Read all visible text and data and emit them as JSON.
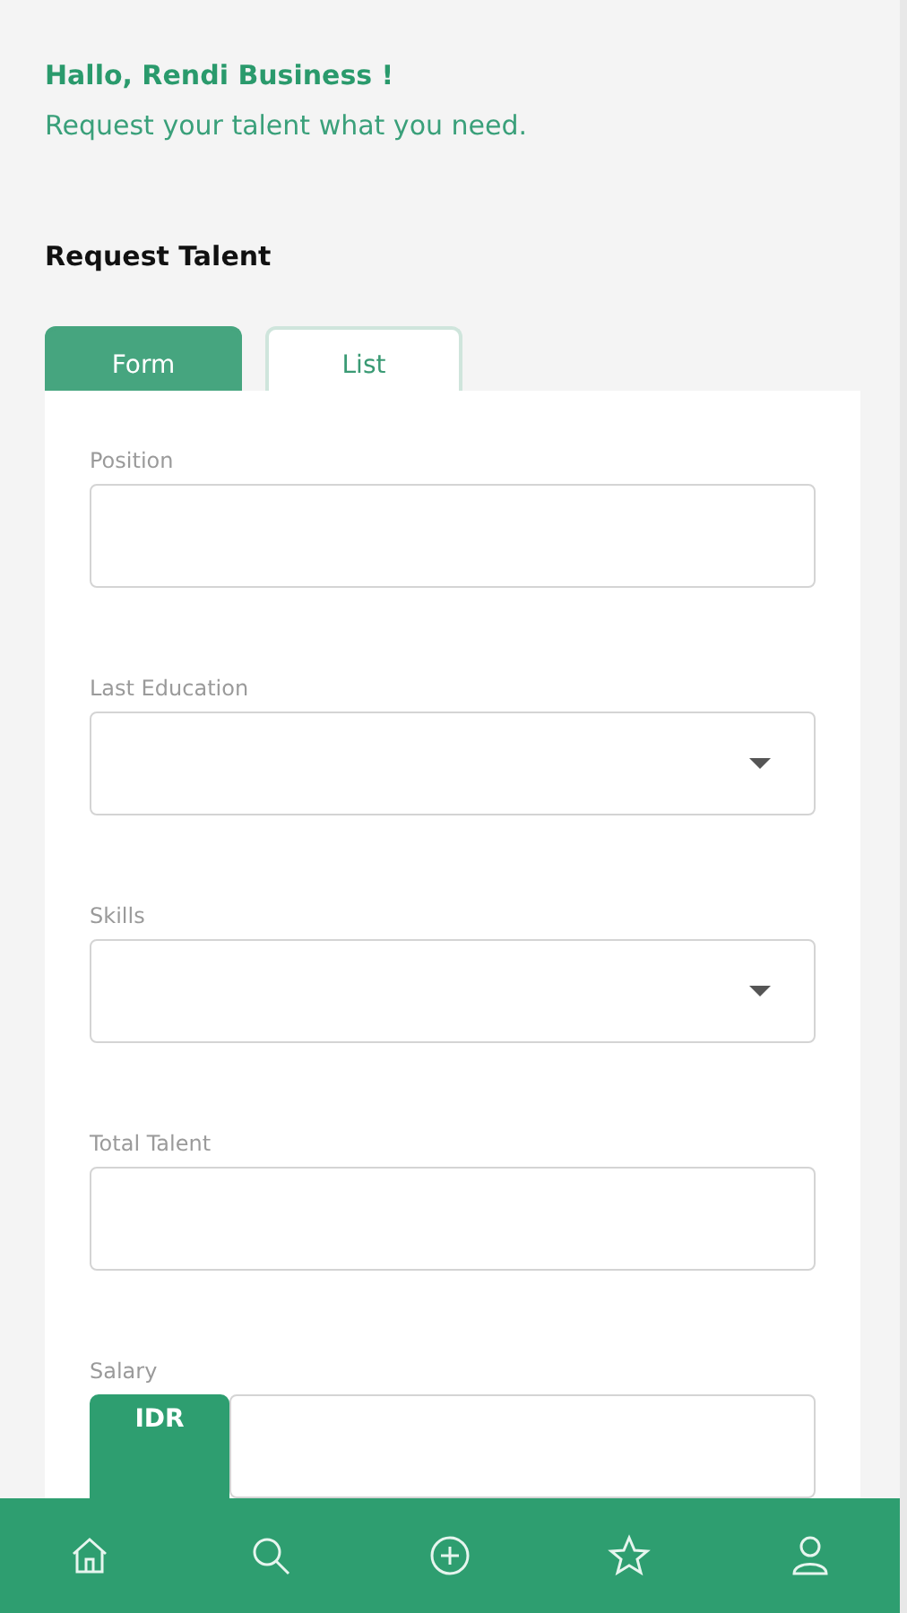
{
  "greeting": {
    "title": "Hallo, Rendi Business !",
    "subtitle": "Request your talent what you need."
  },
  "section_title": "Request Talent",
  "tabs": [
    {
      "label": "Form",
      "selected": true
    },
    {
      "label": "List",
      "selected": false
    }
  ],
  "fields": [
    {
      "label": "Position",
      "kind": "text"
    },
    {
      "label": "Last Education",
      "kind": "dropdown"
    },
    {
      "label": "Skills",
      "kind": "dropdown"
    },
    {
      "label": "Total Talent",
      "kind": "text"
    },
    {
      "label": "Salary",
      "kind": "currency",
      "prefix": "IDR"
    }
  ]
}
